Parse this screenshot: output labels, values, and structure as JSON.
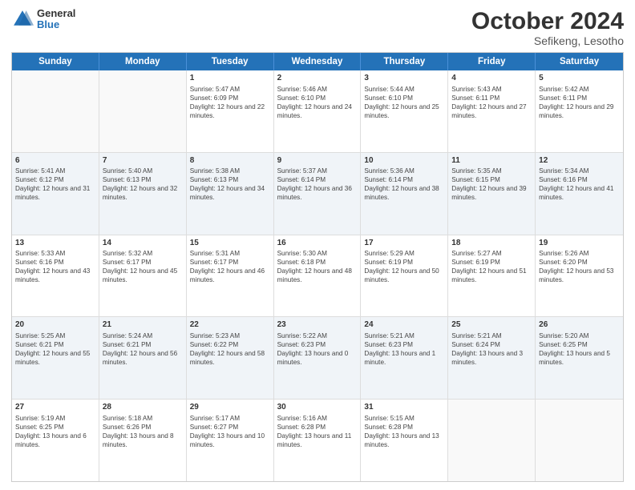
{
  "header": {
    "logo_line1": "General",
    "logo_line2": "Blue",
    "title": "October 2024",
    "subtitle": "Sefikeng, Lesotho"
  },
  "calendar": {
    "days": [
      "Sunday",
      "Monday",
      "Tuesday",
      "Wednesday",
      "Thursday",
      "Friday",
      "Saturday"
    ],
    "weeks": [
      [
        {
          "day": "",
          "sunrise": "",
          "sunset": "",
          "daylight": "",
          "empty": true
        },
        {
          "day": "",
          "sunrise": "",
          "sunset": "",
          "daylight": "",
          "empty": true
        },
        {
          "day": "1",
          "sunrise": "Sunrise: 5:47 AM",
          "sunset": "Sunset: 6:09 PM",
          "daylight": "Daylight: 12 hours and 22 minutes.",
          "empty": false
        },
        {
          "day": "2",
          "sunrise": "Sunrise: 5:46 AM",
          "sunset": "Sunset: 6:10 PM",
          "daylight": "Daylight: 12 hours and 24 minutes.",
          "empty": false
        },
        {
          "day": "3",
          "sunrise": "Sunrise: 5:44 AM",
          "sunset": "Sunset: 6:10 PM",
          "daylight": "Daylight: 12 hours and 25 minutes.",
          "empty": false
        },
        {
          "day": "4",
          "sunrise": "Sunrise: 5:43 AM",
          "sunset": "Sunset: 6:11 PM",
          "daylight": "Daylight: 12 hours and 27 minutes.",
          "empty": false
        },
        {
          "day": "5",
          "sunrise": "Sunrise: 5:42 AM",
          "sunset": "Sunset: 6:11 PM",
          "daylight": "Daylight: 12 hours and 29 minutes.",
          "empty": false
        }
      ],
      [
        {
          "day": "6",
          "sunrise": "Sunrise: 5:41 AM",
          "sunset": "Sunset: 6:12 PM",
          "daylight": "Daylight: 12 hours and 31 minutes.",
          "empty": false
        },
        {
          "day": "7",
          "sunrise": "Sunrise: 5:40 AM",
          "sunset": "Sunset: 6:13 PM",
          "daylight": "Daylight: 12 hours and 32 minutes.",
          "empty": false
        },
        {
          "day": "8",
          "sunrise": "Sunrise: 5:38 AM",
          "sunset": "Sunset: 6:13 PM",
          "daylight": "Daylight: 12 hours and 34 minutes.",
          "empty": false
        },
        {
          "day": "9",
          "sunrise": "Sunrise: 5:37 AM",
          "sunset": "Sunset: 6:14 PM",
          "daylight": "Daylight: 12 hours and 36 minutes.",
          "empty": false
        },
        {
          "day": "10",
          "sunrise": "Sunrise: 5:36 AM",
          "sunset": "Sunset: 6:14 PM",
          "daylight": "Daylight: 12 hours and 38 minutes.",
          "empty": false
        },
        {
          "day": "11",
          "sunrise": "Sunrise: 5:35 AM",
          "sunset": "Sunset: 6:15 PM",
          "daylight": "Daylight: 12 hours and 39 minutes.",
          "empty": false
        },
        {
          "day": "12",
          "sunrise": "Sunrise: 5:34 AM",
          "sunset": "Sunset: 6:16 PM",
          "daylight": "Daylight: 12 hours and 41 minutes.",
          "empty": false
        }
      ],
      [
        {
          "day": "13",
          "sunrise": "Sunrise: 5:33 AM",
          "sunset": "Sunset: 6:16 PM",
          "daylight": "Daylight: 12 hours and 43 minutes.",
          "empty": false
        },
        {
          "day": "14",
          "sunrise": "Sunrise: 5:32 AM",
          "sunset": "Sunset: 6:17 PM",
          "daylight": "Daylight: 12 hours and 45 minutes.",
          "empty": false
        },
        {
          "day": "15",
          "sunrise": "Sunrise: 5:31 AM",
          "sunset": "Sunset: 6:17 PM",
          "daylight": "Daylight: 12 hours and 46 minutes.",
          "empty": false
        },
        {
          "day": "16",
          "sunrise": "Sunrise: 5:30 AM",
          "sunset": "Sunset: 6:18 PM",
          "daylight": "Daylight: 12 hours and 48 minutes.",
          "empty": false
        },
        {
          "day": "17",
          "sunrise": "Sunrise: 5:29 AM",
          "sunset": "Sunset: 6:19 PM",
          "daylight": "Daylight: 12 hours and 50 minutes.",
          "empty": false
        },
        {
          "day": "18",
          "sunrise": "Sunrise: 5:27 AM",
          "sunset": "Sunset: 6:19 PM",
          "daylight": "Daylight: 12 hours and 51 minutes.",
          "empty": false
        },
        {
          "day": "19",
          "sunrise": "Sunrise: 5:26 AM",
          "sunset": "Sunset: 6:20 PM",
          "daylight": "Daylight: 12 hours and 53 minutes.",
          "empty": false
        }
      ],
      [
        {
          "day": "20",
          "sunrise": "Sunrise: 5:25 AM",
          "sunset": "Sunset: 6:21 PM",
          "daylight": "Daylight: 12 hours and 55 minutes.",
          "empty": false
        },
        {
          "day": "21",
          "sunrise": "Sunrise: 5:24 AM",
          "sunset": "Sunset: 6:21 PM",
          "daylight": "Daylight: 12 hours and 56 minutes.",
          "empty": false
        },
        {
          "day": "22",
          "sunrise": "Sunrise: 5:23 AM",
          "sunset": "Sunset: 6:22 PM",
          "daylight": "Daylight: 12 hours and 58 minutes.",
          "empty": false
        },
        {
          "day": "23",
          "sunrise": "Sunrise: 5:22 AM",
          "sunset": "Sunset: 6:23 PM",
          "daylight": "Daylight: 13 hours and 0 minutes.",
          "empty": false
        },
        {
          "day": "24",
          "sunrise": "Sunrise: 5:21 AM",
          "sunset": "Sunset: 6:23 PM",
          "daylight": "Daylight: 13 hours and 1 minute.",
          "empty": false
        },
        {
          "day": "25",
          "sunrise": "Sunrise: 5:21 AM",
          "sunset": "Sunset: 6:24 PM",
          "daylight": "Daylight: 13 hours and 3 minutes.",
          "empty": false
        },
        {
          "day": "26",
          "sunrise": "Sunrise: 5:20 AM",
          "sunset": "Sunset: 6:25 PM",
          "daylight": "Daylight: 13 hours and 5 minutes.",
          "empty": false
        }
      ],
      [
        {
          "day": "27",
          "sunrise": "Sunrise: 5:19 AM",
          "sunset": "Sunset: 6:25 PM",
          "daylight": "Daylight: 13 hours and 6 minutes.",
          "empty": false
        },
        {
          "day": "28",
          "sunrise": "Sunrise: 5:18 AM",
          "sunset": "Sunset: 6:26 PM",
          "daylight": "Daylight: 13 hours and 8 minutes.",
          "empty": false
        },
        {
          "day": "29",
          "sunrise": "Sunrise: 5:17 AM",
          "sunset": "Sunset: 6:27 PM",
          "daylight": "Daylight: 13 hours and 10 minutes.",
          "empty": false
        },
        {
          "day": "30",
          "sunrise": "Sunrise: 5:16 AM",
          "sunset": "Sunset: 6:28 PM",
          "daylight": "Daylight: 13 hours and 11 minutes.",
          "empty": false
        },
        {
          "day": "31",
          "sunrise": "Sunrise: 5:15 AM",
          "sunset": "Sunset: 6:28 PM",
          "daylight": "Daylight: 13 hours and 13 minutes.",
          "empty": false
        },
        {
          "day": "",
          "sunrise": "",
          "sunset": "",
          "daylight": "",
          "empty": true
        },
        {
          "day": "",
          "sunrise": "",
          "sunset": "",
          "daylight": "",
          "empty": true
        }
      ]
    ]
  }
}
